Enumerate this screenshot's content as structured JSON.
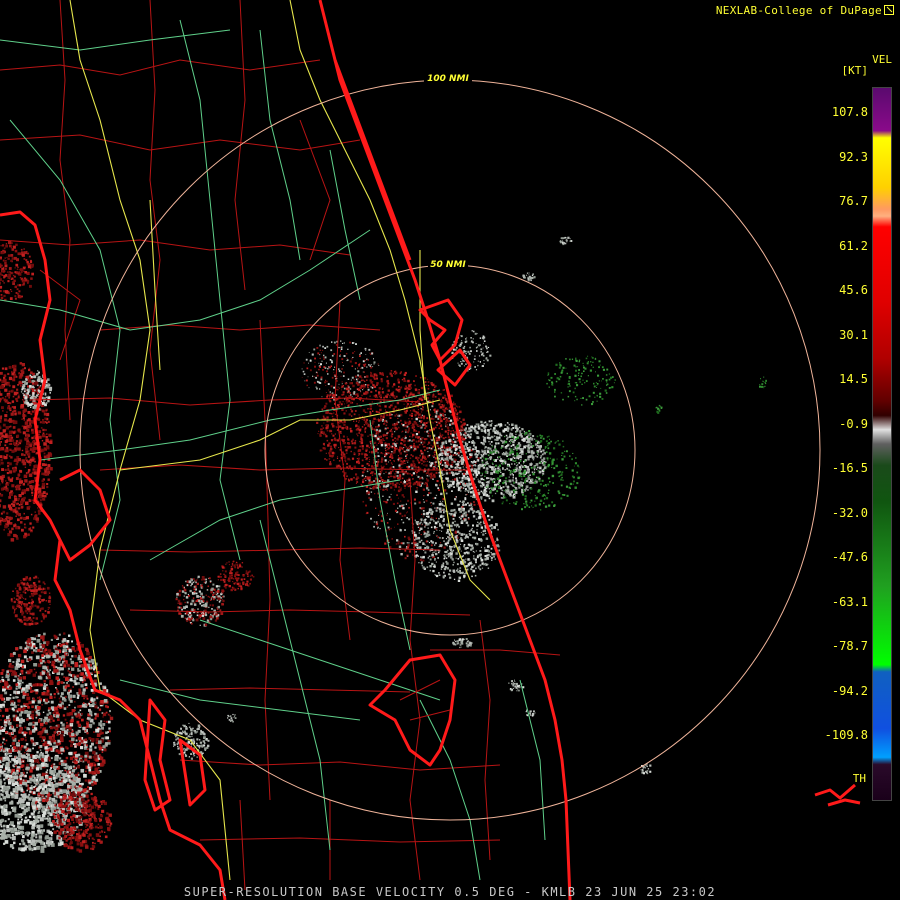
{
  "credit": "NEXLAB-College of DuPage",
  "product_label": "VEL",
  "unit_label": "[KT]",
  "scale": {
    "ticks": [
      "107.8",
      "92.3",
      "76.7",
      "61.2",
      "45.6",
      "30.1",
      "14.5",
      "-0.9",
      "-16.5",
      "-32.0",
      "-47.6",
      "-63.1",
      "-78.7",
      "-94.2",
      "-109.8"
    ]
  },
  "legend_extra": "TH",
  "rings": [
    {
      "label": "100 NMI"
    },
    {
      "label": "50 NMI"
    }
  ],
  "footer": "SUPER-RESOLUTION BASE VELOCITY 0.5 DEG - KMLB 23 JUN 25 23:02",
  "colors": {
    "background": "#000000",
    "label": "#ffff33",
    "coast": "#ff1a1a",
    "county": "#b81414",
    "highway": "#e6e64c",
    "road": "#5fd08a",
    "ring": "#f0b49a",
    "inbound": "#2e8b2e",
    "outbound": "#8b1010",
    "neutral": "#b8bcb8"
  }
}
